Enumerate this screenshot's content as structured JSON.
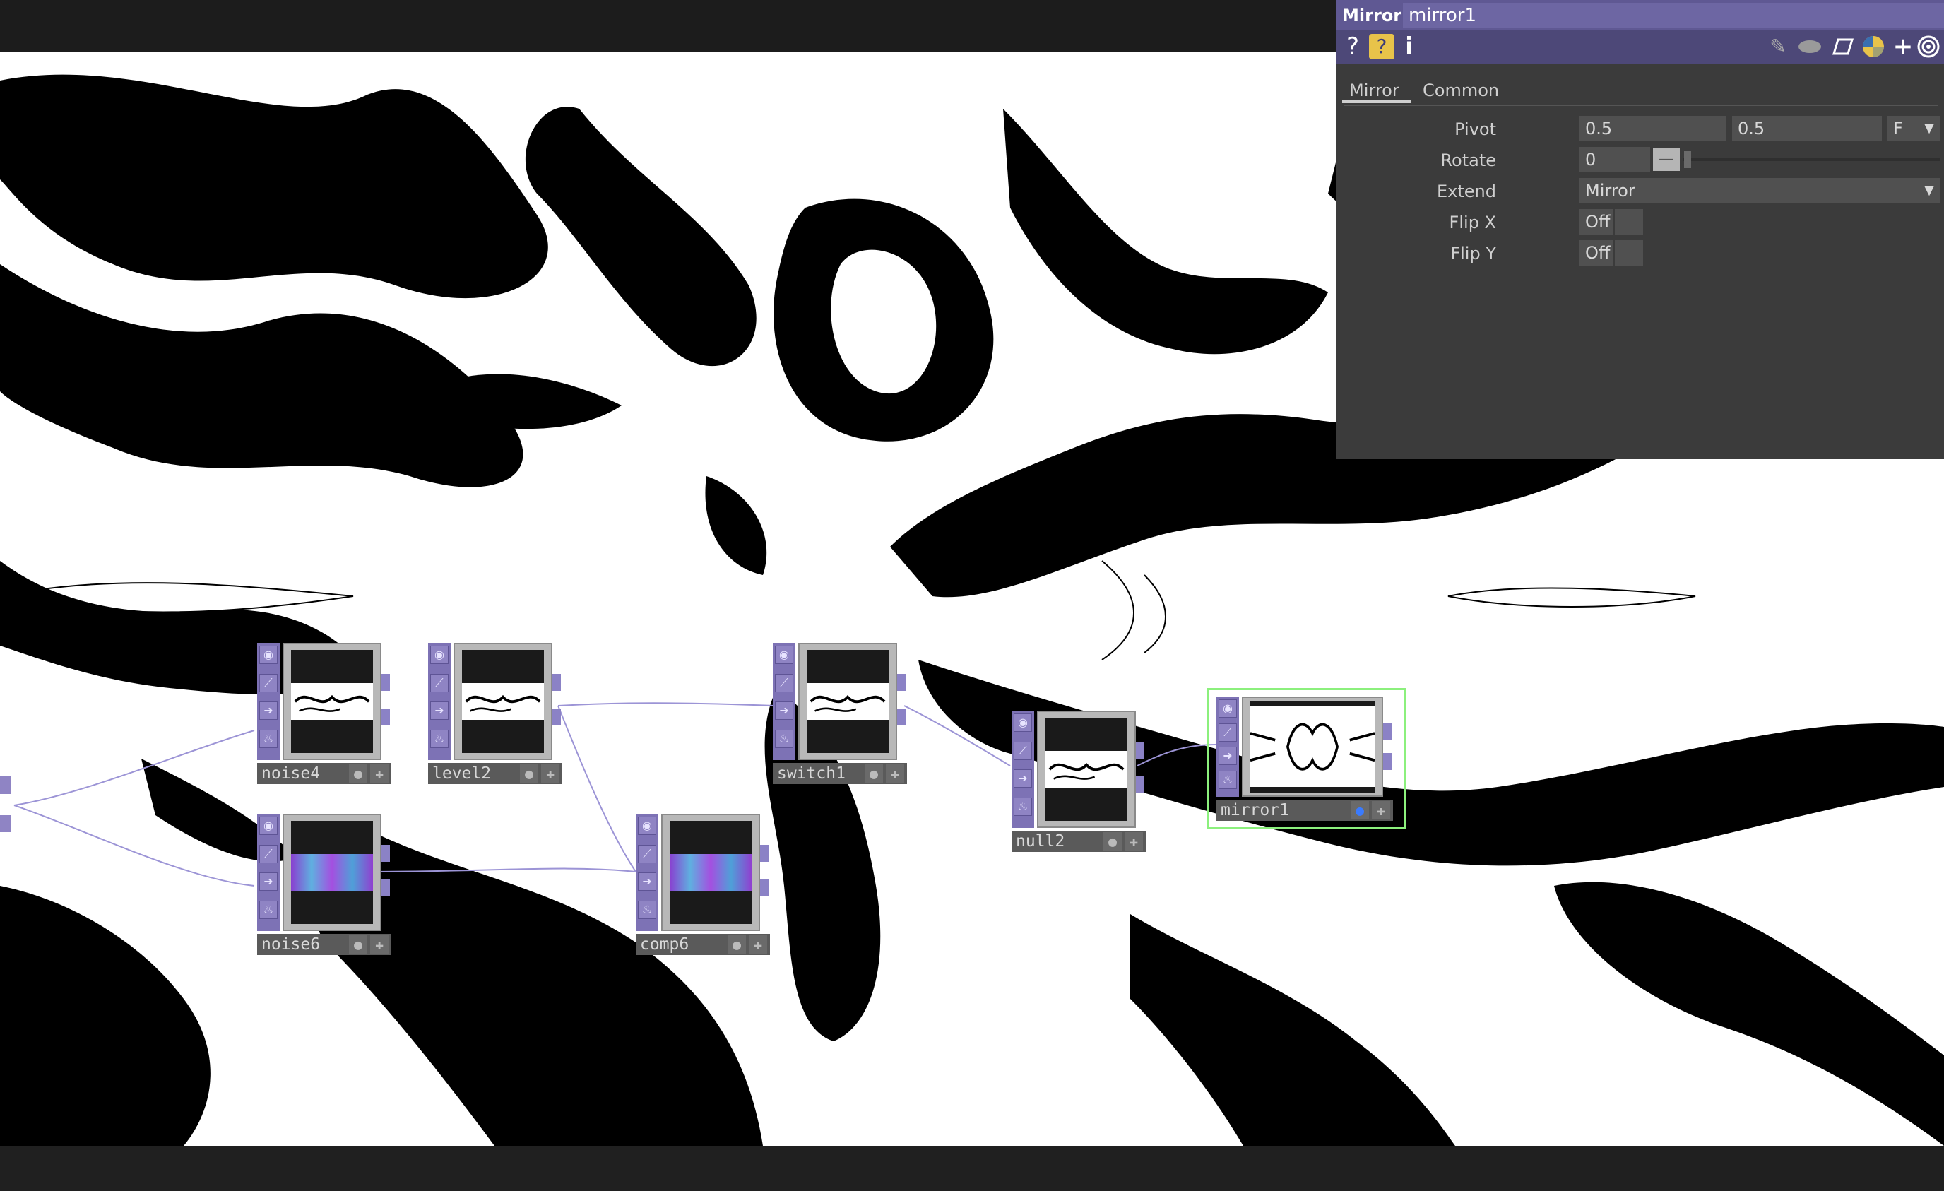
{
  "panel": {
    "operator_type": "Mirror",
    "node_name": "mirror1",
    "tabs": [
      "Mirror",
      "Common"
    ],
    "params": {
      "pivot": {
        "label": "Pivot",
        "x": "0.5",
        "y": "0.5",
        "mode": "F"
      },
      "rotate": {
        "label": "Rotate",
        "value": "0",
        "slider_position": 0.0
      },
      "extend": {
        "label": "Extend",
        "value": "Mirror"
      },
      "flipx": {
        "label": "Flip X",
        "value": "Off"
      },
      "flipy": {
        "label": "Flip Y",
        "value": "Off"
      }
    },
    "toolbar_icons": [
      "help-icon",
      "python-help-icon",
      "info-icon",
      "edit-icon",
      "comment-icon",
      "clone-icon",
      "python-icon",
      "add-icon",
      "target-icon"
    ]
  },
  "nodes": [
    {
      "id": "noise4",
      "label": "noise4",
      "thumb": "bw"
    },
    {
      "id": "level2",
      "label": "level2",
      "thumb": "bw"
    },
    {
      "id": "switch1",
      "label": "switch1",
      "thumb": "bw"
    },
    {
      "id": "null2",
      "label": "null2",
      "thumb": "bw"
    },
    {
      "id": "mirror1",
      "label": "mirror1",
      "thumb": "mirror",
      "selected": true
    },
    {
      "id": "noise6",
      "label": "noise6",
      "thumb": "purple"
    },
    {
      "id": "comp6",
      "label": "comp6",
      "thumb": "purple"
    }
  ],
  "colors": {
    "panel_bg": "#3b3b3b",
    "title_bar": "#5f5893",
    "toolbar": "#4d4878",
    "node_tile": "#7d72b5",
    "selection": "#8cf07d",
    "wire": "#9c94d6"
  }
}
